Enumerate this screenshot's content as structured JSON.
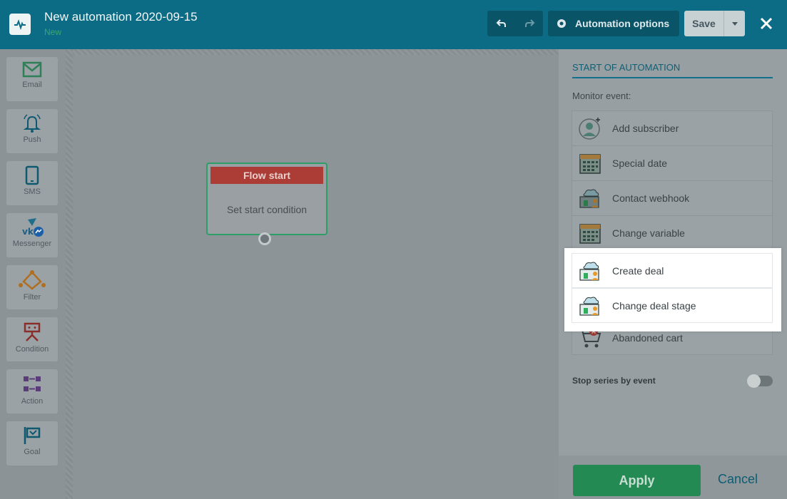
{
  "header": {
    "title": "New automation 2020-09-15",
    "status": "New",
    "options_label": "Automation options",
    "save_label": "Save"
  },
  "toolbar": {
    "items": [
      {
        "label": "Email",
        "icon": "email-icon"
      },
      {
        "label": "Push",
        "icon": "bell-icon"
      },
      {
        "label": "SMS",
        "icon": "phone-icon"
      },
      {
        "label": "Messenger",
        "icon": "messenger-icon"
      },
      {
        "label": "Filter",
        "icon": "filter-icon"
      },
      {
        "label": "Condition",
        "icon": "condition-icon"
      },
      {
        "label": "Action",
        "icon": "action-icon"
      },
      {
        "label": "Goal",
        "icon": "flag-icon"
      }
    ]
  },
  "canvas": {
    "node_title": "Flow start",
    "node_body": "Set start condition"
  },
  "panel": {
    "title": "START OF AUTOMATION",
    "monitor_label": "Monitor event:",
    "events": [
      {
        "label": "Add subscriber",
        "icon": "add-subscriber-icon"
      },
      {
        "label": "Special date",
        "icon": "calendar-icon"
      },
      {
        "label": "Contact webhook",
        "icon": "webhook-icon"
      },
      {
        "label": "Change variable",
        "icon": "calendar-icon"
      },
      {
        "label": "Create deal",
        "icon": "deal-icon"
      },
      {
        "label": "Change deal stage",
        "icon": "deal-icon"
      },
      {
        "label": "Abandoned cart",
        "icon": "cart-icon"
      }
    ],
    "stop_label": "Stop series by event",
    "apply_label": "Apply",
    "cancel_label": "Cancel"
  },
  "colors": {
    "header": "#0d6c85",
    "accent_green": "#2e9e67",
    "node_header_red": "#ab3c36"
  }
}
